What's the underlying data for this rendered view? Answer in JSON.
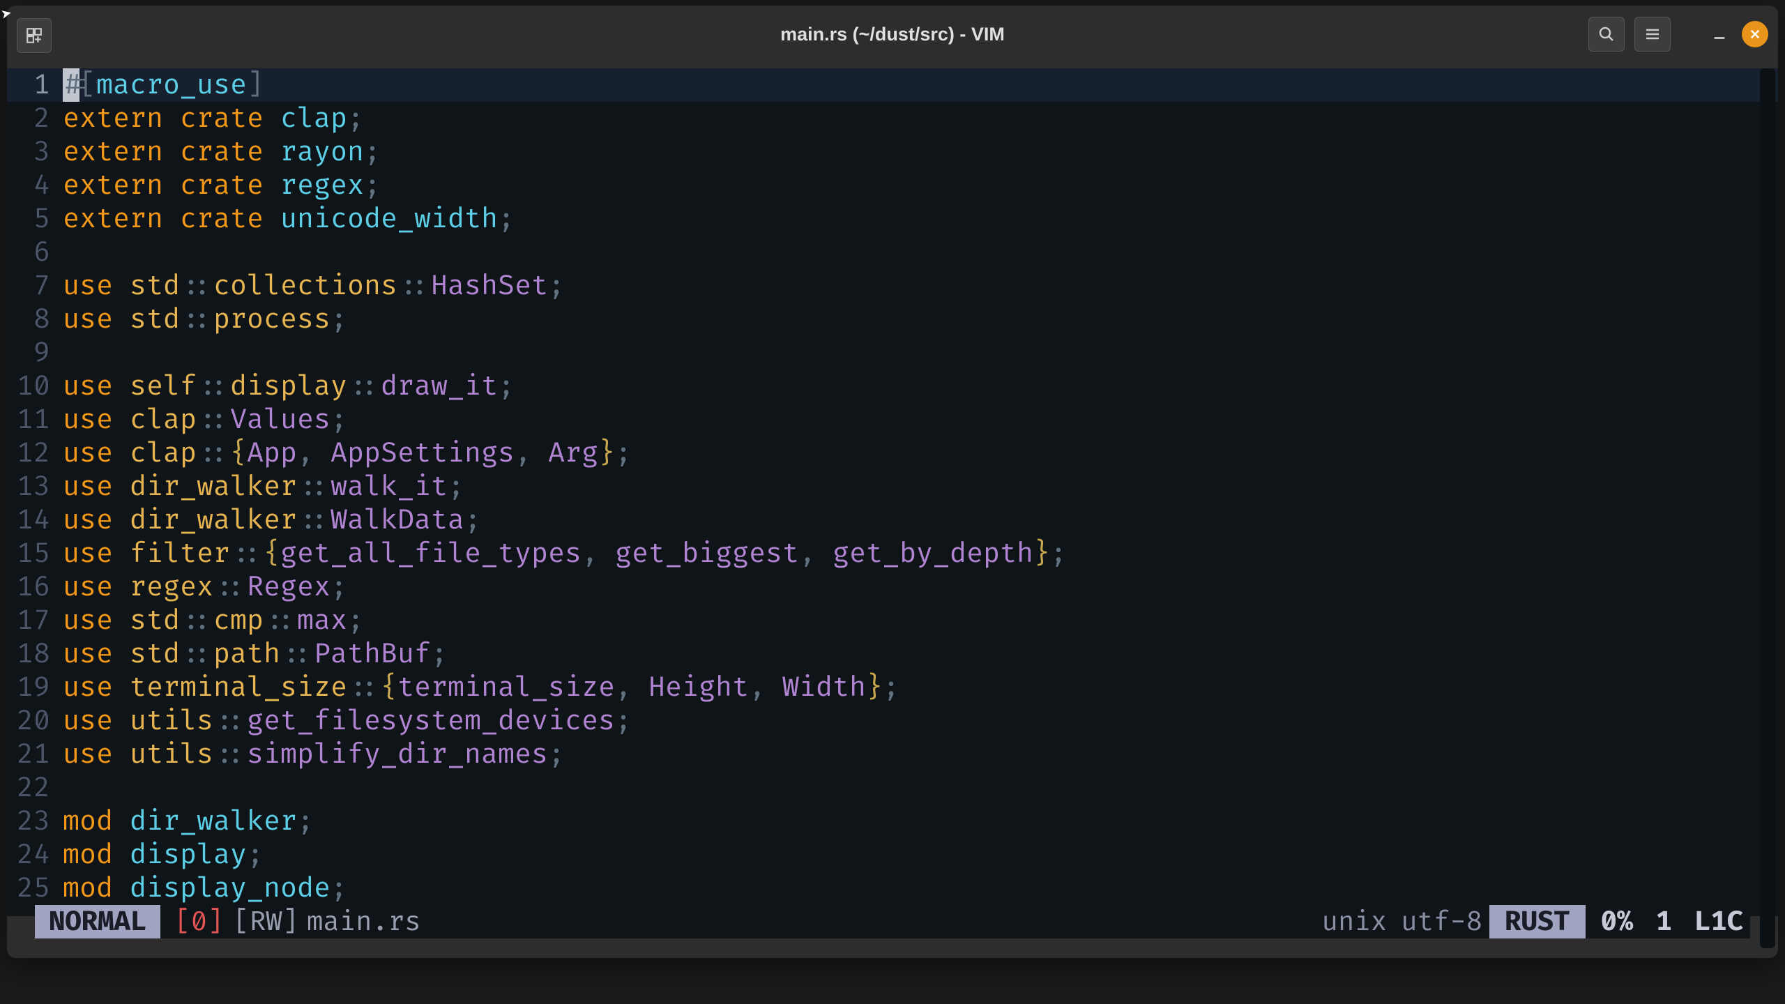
{
  "window": {
    "title": "main.rs (~/dust/src) - VIM"
  },
  "code_lines": [
    [
      {
        "txt": "#",
        "cls": "cursor-block"
      },
      {
        "txt": "[",
        "cls": "punct"
      },
      {
        "txt": "macro_use",
        "cls": "ident-teal"
      },
      {
        "txt": "]",
        "cls": "punct"
      }
    ],
    [
      {
        "txt": "extern crate ",
        "cls": "kw-orange"
      },
      {
        "txt": "clap",
        "cls": "ident-teal"
      },
      {
        "txt": ";",
        "cls": "punct"
      }
    ],
    [
      {
        "txt": "extern crate ",
        "cls": "kw-orange"
      },
      {
        "txt": "rayon",
        "cls": "ident-teal"
      },
      {
        "txt": ";",
        "cls": "punct"
      }
    ],
    [
      {
        "txt": "extern crate ",
        "cls": "kw-orange"
      },
      {
        "txt": "regex",
        "cls": "ident-teal"
      },
      {
        "txt": ";",
        "cls": "punct"
      }
    ],
    [
      {
        "txt": "extern crate ",
        "cls": "kw-orange"
      },
      {
        "txt": "unicode_width",
        "cls": "ident-teal"
      },
      {
        "txt": ";",
        "cls": "punct"
      }
    ],
    [],
    [
      {
        "txt": "use ",
        "cls": "kw-orange"
      },
      {
        "txt": "std",
        "cls": "kw-yellow"
      },
      {
        "txt": "::",
        "cls": "punct"
      },
      {
        "txt": "collections",
        "cls": "kw-yellow"
      },
      {
        "txt": "::",
        "cls": "punct"
      },
      {
        "txt": "HashSet",
        "cls": "ident-purple"
      },
      {
        "txt": ";",
        "cls": "punct"
      }
    ],
    [
      {
        "txt": "use ",
        "cls": "kw-orange"
      },
      {
        "txt": "std",
        "cls": "kw-yellow"
      },
      {
        "txt": "::",
        "cls": "punct"
      },
      {
        "txt": "process",
        "cls": "kw-yellow"
      },
      {
        "txt": ";",
        "cls": "punct"
      }
    ],
    [],
    [
      {
        "txt": "use ",
        "cls": "kw-orange"
      },
      {
        "txt": "self",
        "cls": "kw-yellow"
      },
      {
        "txt": "::",
        "cls": "punct"
      },
      {
        "txt": "display",
        "cls": "kw-yellow"
      },
      {
        "txt": "::",
        "cls": "punct"
      },
      {
        "txt": "draw_it",
        "cls": "ident-purple"
      },
      {
        "txt": ";",
        "cls": "punct"
      }
    ],
    [
      {
        "txt": "use ",
        "cls": "kw-orange"
      },
      {
        "txt": "clap",
        "cls": "kw-yellow"
      },
      {
        "txt": "::",
        "cls": "punct"
      },
      {
        "txt": "Values",
        "cls": "ident-purple"
      },
      {
        "txt": ";",
        "cls": "punct"
      }
    ],
    [
      {
        "txt": "use ",
        "cls": "kw-orange"
      },
      {
        "txt": "clap",
        "cls": "kw-yellow"
      },
      {
        "txt": "::",
        "cls": "punct"
      },
      {
        "txt": "{",
        "cls": "brace"
      },
      {
        "txt": "App",
        "cls": "ident-purple"
      },
      {
        "txt": ", ",
        "cls": "punct"
      },
      {
        "txt": "AppSettings",
        "cls": "ident-purple"
      },
      {
        "txt": ", ",
        "cls": "punct"
      },
      {
        "txt": "Arg",
        "cls": "ident-purple"
      },
      {
        "txt": "}",
        "cls": "brace"
      },
      {
        "txt": ";",
        "cls": "punct"
      }
    ],
    [
      {
        "txt": "use ",
        "cls": "kw-orange"
      },
      {
        "txt": "dir_walker",
        "cls": "kw-yellow"
      },
      {
        "txt": "::",
        "cls": "punct"
      },
      {
        "txt": "walk_it",
        "cls": "ident-purple"
      },
      {
        "txt": ";",
        "cls": "punct"
      }
    ],
    [
      {
        "txt": "use ",
        "cls": "kw-orange"
      },
      {
        "txt": "dir_walker",
        "cls": "kw-yellow"
      },
      {
        "txt": "::",
        "cls": "punct"
      },
      {
        "txt": "WalkData",
        "cls": "ident-purple"
      },
      {
        "txt": ";",
        "cls": "punct"
      }
    ],
    [
      {
        "txt": "use ",
        "cls": "kw-orange"
      },
      {
        "txt": "filter",
        "cls": "kw-yellow"
      },
      {
        "txt": "::",
        "cls": "punct"
      },
      {
        "txt": "{",
        "cls": "brace"
      },
      {
        "txt": "get_all_file_types",
        "cls": "ident-purple"
      },
      {
        "txt": ", ",
        "cls": "punct"
      },
      {
        "txt": "get_biggest",
        "cls": "ident-purple"
      },
      {
        "txt": ", ",
        "cls": "punct"
      },
      {
        "txt": "get_by_depth",
        "cls": "ident-purple"
      },
      {
        "txt": "}",
        "cls": "brace"
      },
      {
        "txt": ";",
        "cls": "punct"
      }
    ],
    [
      {
        "txt": "use ",
        "cls": "kw-orange"
      },
      {
        "txt": "regex",
        "cls": "kw-yellow"
      },
      {
        "txt": "::",
        "cls": "punct"
      },
      {
        "txt": "Regex",
        "cls": "ident-purple"
      },
      {
        "txt": ";",
        "cls": "punct"
      }
    ],
    [
      {
        "txt": "use ",
        "cls": "kw-orange"
      },
      {
        "txt": "std",
        "cls": "kw-yellow"
      },
      {
        "txt": "::",
        "cls": "punct"
      },
      {
        "txt": "cmp",
        "cls": "kw-yellow"
      },
      {
        "txt": "::",
        "cls": "punct"
      },
      {
        "txt": "max",
        "cls": "ident-purple"
      },
      {
        "txt": ";",
        "cls": "punct"
      }
    ],
    [
      {
        "txt": "use ",
        "cls": "kw-orange"
      },
      {
        "txt": "std",
        "cls": "kw-yellow"
      },
      {
        "txt": "::",
        "cls": "punct"
      },
      {
        "txt": "path",
        "cls": "kw-yellow"
      },
      {
        "txt": "::",
        "cls": "punct"
      },
      {
        "txt": "PathBuf",
        "cls": "ident-purple"
      },
      {
        "txt": ";",
        "cls": "punct"
      }
    ],
    [
      {
        "txt": "use ",
        "cls": "kw-orange"
      },
      {
        "txt": "terminal_size",
        "cls": "kw-yellow"
      },
      {
        "txt": "::",
        "cls": "punct"
      },
      {
        "txt": "{",
        "cls": "brace"
      },
      {
        "txt": "terminal_size",
        "cls": "ident-purple"
      },
      {
        "txt": ", ",
        "cls": "punct"
      },
      {
        "txt": "Height",
        "cls": "ident-purple"
      },
      {
        "txt": ", ",
        "cls": "punct"
      },
      {
        "txt": "Width",
        "cls": "ident-purple"
      },
      {
        "txt": "}",
        "cls": "brace"
      },
      {
        "txt": ";",
        "cls": "punct"
      }
    ],
    [
      {
        "txt": "use ",
        "cls": "kw-orange"
      },
      {
        "txt": "utils",
        "cls": "kw-yellow"
      },
      {
        "txt": "::",
        "cls": "punct"
      },
      {
        "txt": "get_filesystem_devices",
        "cls": "ident-purple"
      },
      {
        "txt": ";",
        "cls": "punct"
      }
    ],
    [
      {
        "txt": "use ",
        "cls": "kw-orange"
      },
      {
        "txt": "utils",
        "cls": "kw-yellow"
      },
      {
        "txt": "::",
        "cls": "punct"
      },
      {
        "txt": "simplify_dir_names",
        "cls": "ident-purple"
      },
      {
        "txt": ";",
        "cls": "punct"
      }
    ],
    [],
    [
      {
        "txt": "mod ",
        "cls": "kw-orange"
      },
      {
        "txt": "dir_walker",
        "cls": "ident-teal"
      },
      {
        "txt": ";",
        "cls": "punct"
      }
    ],
    [
      {
        "txt": "mod ",
        "cls": "kw-orange"
      },
      {
        "txt": "display",
        "cls": "ident-teal"
      },
      {
        "txt": ";",
        "cls": "punct"
      }
    ],
    [
      {
        "txt": "mod ",
        "cls": "kw-orange"
      },
      {
        "txt": "display_node",
        "cls": "ident-teal"
      },
      {
        "txt": ";",
        "cls": "punct"
      }
    ]
  ],
  "current_line": 1,
  "status": {
    "mode": "NORMAL",
    "bufnum": "[0]",
    "rw": "[RW]",
    "filename": "main.rs",
    "enc_os": "unix",
    "encoding": "utf-8",
    "lang": "RUST",
    "percent": "0%",
    "line": "1",
    "col": "L1C"
  }
}
